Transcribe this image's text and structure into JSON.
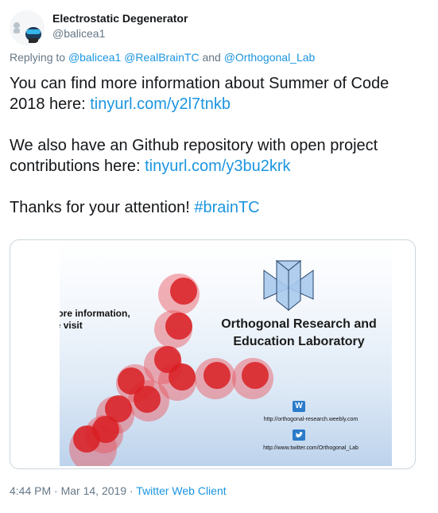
{
  "tweet": {
    "author": {
      "display_name": "Electrostatic Degenerator",
      "handle": "@balicea1"
    },
    "reply": {
      "prefix": "Replying to",
      "mentions": [
        "@balicea1",
        "@RealBrainTC",
        "@Orthogonal_Lab"
      ],
      "joiner": "and"
    },
    "paragraphs": [
      {
        "text": "You can find more information about Summer of Code 2018 here: ",
        "link": "tinyurl.com/y2l7tnkb"
      },
      {
        "text": "We also have an Github repository with open project contributions here: ",
        "link": "tinyurl.com/y3bu2krk"
      },
      {
        "text": "Thanks for your attention! ",
        "link": "#brainTC"
      }
    ],
    "image": {
      "info_text": "For more information, please visit",
      "title": "Orthogonal Research and Education Laboratory",
      "weebly_url": "http://orthogonal-research.weebly.com",
      "twitter_url": "http://www.twitter.com/Orthogonal_Lab",
      "weebly_icon": "weebly-icon",
      "twitter_icon": "twitter-icon"
    },
    "meta": {
      "time": "4:44 PM",
      "date": "Mar 14, 2019",
      "separator": "·",
      "client": "Twitter Web Client"
    }
  },
  "colors": {
    "link": "#1b95e0",
    "muted": "#657786",
    "text": "#14171a",
    "card_border": "#ccd6dd"
  }
}
